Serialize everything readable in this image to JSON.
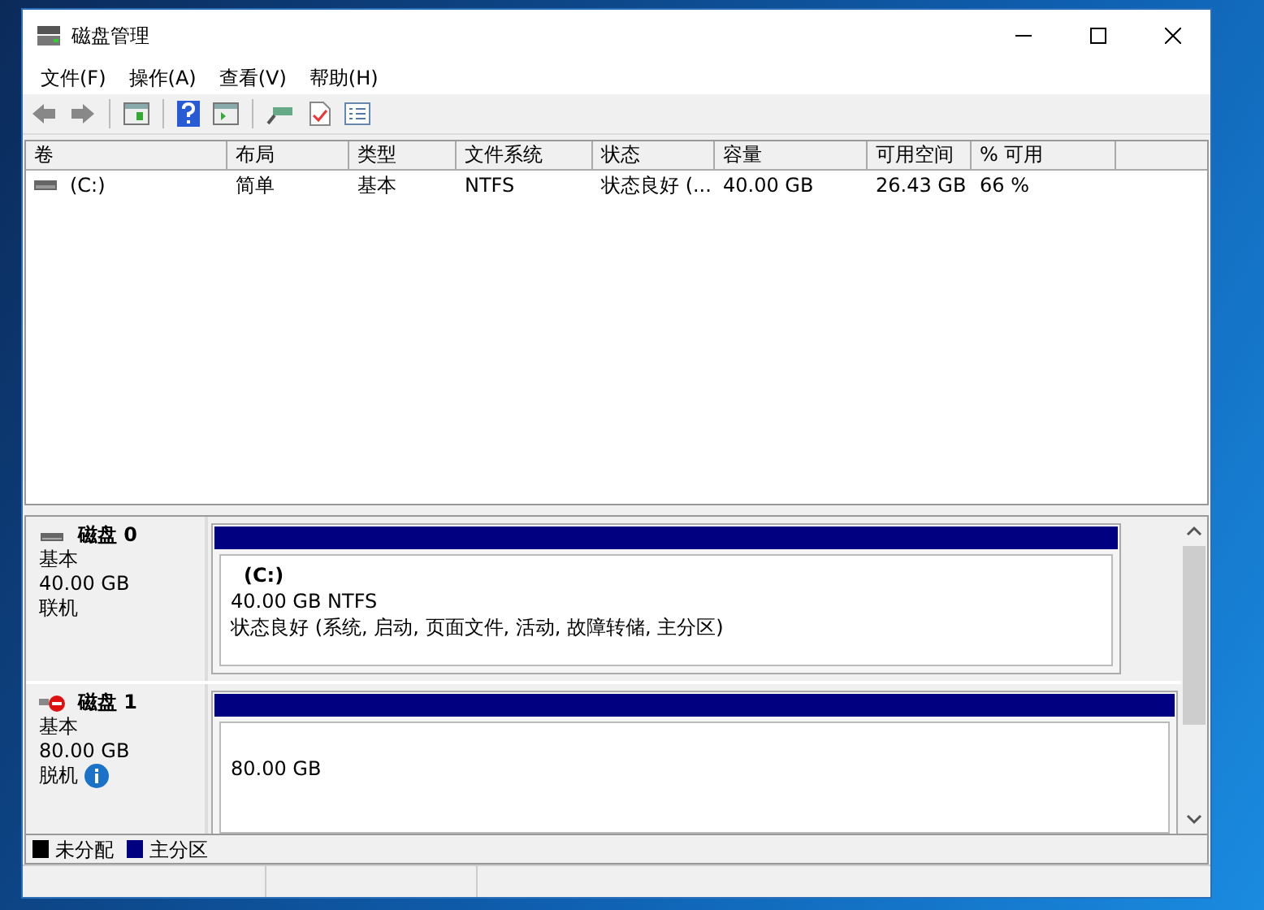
{
  "window": {
    "title": "磁盘管理"
  },
  "menu": [
    "文件(F)",
    "操作(A)",
    "查看(V)",
    "帮助(H)"
  ],
  "table": {
    "columns": [
      "卷",
      "布局",
      "类型",
      "文件系统",
      "状态",
      "容量",
      "可用空间",
      "% 可用"
    ],
    "rows": [
      {
        "cells": [
          "(C:)",
          "简单",
          "基本",
          "NTFS",
          "状态良好 (...",
          "40.00 GB",
          "26.43 GB",
          "66 %"
        ]
      }
    ]
  },
  "disks": [
    {
      "name": "磁盘 0",
      "type": "基本",
      "size": "40.00 GB",
      "status": "联机",
      "online": true,
      "partitions": [
        {
          "label": "(C:)",
          "size": "40.00 GB NTFS",
          "status": "状态良好 (系统, 启动, 页面文件, 活动, 故障转储, 主分区)",
          "color": "#000080"
        }
      ]
    },
    {
      "name": "磁盘 1",
      "type": "基本",
      "size": "80.00 GB",
      "status": "脱机",
      "online": false,
      "partitions": [
        {
          "size": "80.00 GB",
          "color": "#000080"
        }
      ]
    }
  ],
  "legend": [
    {
      "label": "未分配",
      "color": "#000000"
    },
    {
      "label": "主分区",
      "color": "#000080"
    }
  ]
}
